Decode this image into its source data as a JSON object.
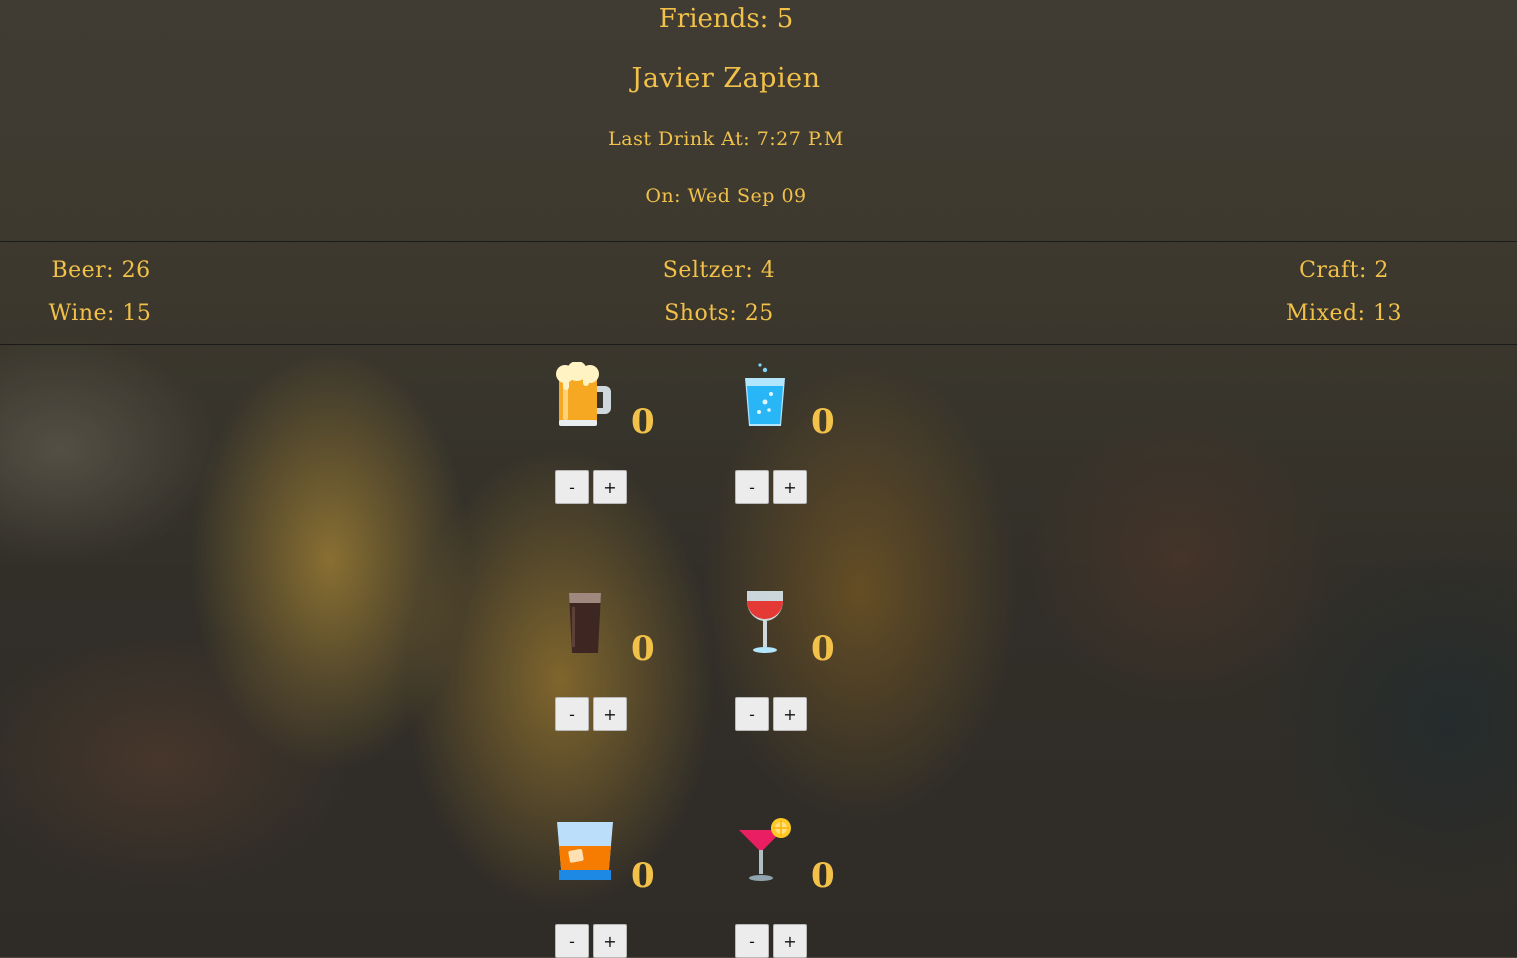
{
  "header": {
    "friends": "Friends: 5",
    "user_name": "Javier Zapien",
    "last_drink": "Last Drink At: 7:27 P.M",
    "on_date": "On: Wed Sep 09"
  },
  "stats": {
    "beer": "Beer: 26",
    "seltzer": "Seltzer: 4",
    "craft": "Craft: 2",
    "wine": "Wine: 15",
    "shots": "Shots: 25",
    "mixed": "Mixed: 13"
  },
  "drinks": [
    {
      "icon": "beer-mug-icon",
      "count": "0",
      "minus": "-",
      "plus": "+"
    },
    {
      "icon": "seltzer-glass-icon",
      "count": "0",
      "minus": "-",
      "plus": "+"
    },
    {
      "icon": "craft-pint-icon",
      "count": "0",
      "minus": "-",
      "plus": "+"
    },
    {
      "icon": "wine-glass-icon",
      "count": "0",
      "minus": "-",
      "plus": "+"
    },
    {
      "icon": "shot-whiskey-glass-icon",
      "count": "0",
      "minus": "-",
      "plus": "+"
    },
    {
      "icon": "cocktail-glass-icon",
      "count": "0",
      "minus": "-",
      "plus": "+"
    }
  ],
  "colors": {
    "text_accent": "#f2c14a",
    "button_bg": "#ececec"
  }
}
